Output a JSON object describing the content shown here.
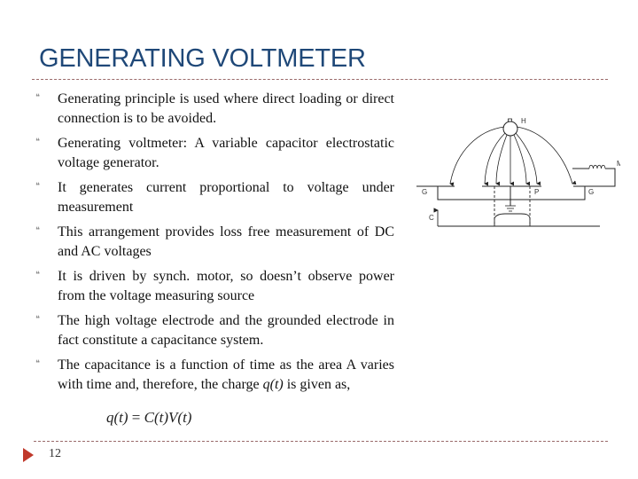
{
  "slide": {
    "title": "GENERATING VOLTMETER",
    "bullet_glyph": "❝",
    "bullets": [
      {
        "text": "Generating principle is used where direct loading or direct connection is to be avoided."
      },
      {
        "text": "Generating voltmeter: A variable capacitor electrostatic voltage generator."
      },
      {
        "text": "It generates current proportional to voltage under measurement"
      },
      {
        "text": "This arrangement provides loss free measurement of DC and AC voltages"
      },
      {
        "text": "It is driven by synch. motor, so doesn’t observe power from the voltage measuring source"
      },
      {
        "text": "The high voltage electrode and the grounded electrode in fact constitute a capacitance system."
      },
      {
        "text_before": "The capacitance is a function of time as the area A varies with time and, therefore, the charge ",
        "text_italic": "q(t)",
        "text_after": " is given as,"
      }
    ],
    "formula": {
      "lhs": "q(t)",
      "equals": " = ",
      "rhs": "C(t)V(t)"
    },
    "page_number": "12"
  },
  "diagram": {
    "labels": {
      "hv_electrode": "H",
      "hv_top_mark": "B",
      "ground_left": "G",
      "ground_right": "G",
      "pickup_plate": "P",
      "motor": "M",
      "axis_label": "C"
    }
  },
  "colors": {
    "title": "#1f4878",
    "rule": "#9a6a6a",
    "page_arrow": "#c0392b",
    "bullet": "#8a8a8a"
  }
}
